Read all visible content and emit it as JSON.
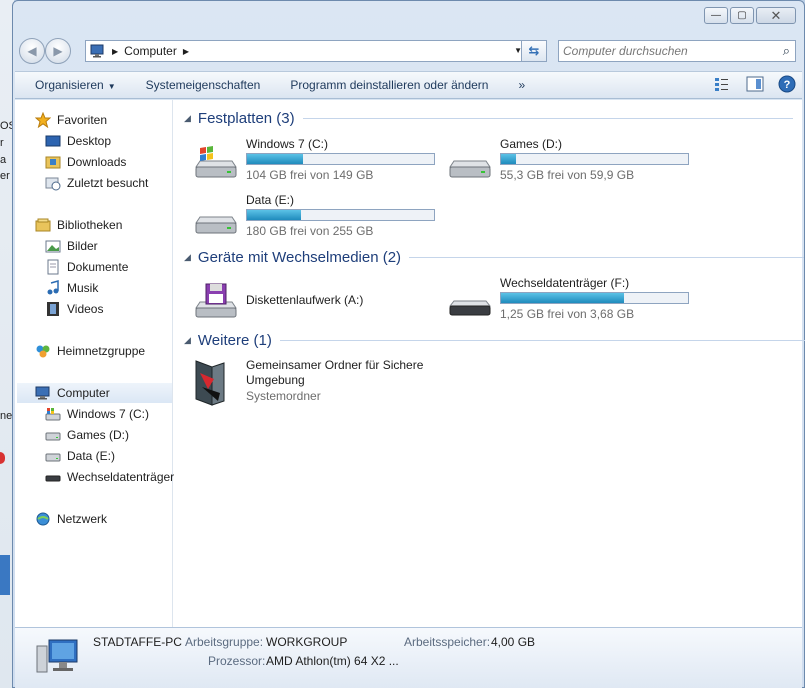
{
  "background_fragments": [
    "OS",
    "r",
    "a",
    "er",
    "ne"
  ],
  "window": {
    "controls": {
      "minimize": "—",
      "maximize": "▢",
      "close": "✕"
    }
  },
  "address": {
    "crumb": "Computer",
    "search_placeholder": "Computer durchsuchen"
  },
  "toolbar": {
    "items": [
      "Organisieren",
      "Systemeigenschaften",
      "Programm deinstallieren oder ändern"
    ],
    "more": "»"
  },
  "sidebar": {
    "favorites": {
      "label": "Favoriten",
      "items": [
        "Desktop",
        "Downloads",
        "Zuletzt besucht"
      ]
    },
    "libraries": {
      "label": "Bibliotheken",
      "items": [
        "Bilder",
        "Dokumente",
        "Musik",
        "Videos"
      ]
    },
    "homegroup": {
      "label": "Heimnetzgruppe"
    },
    "computer": {
      "label": "Computer",
      "items": [
        "Windows 7 (C:)",
        "Games (D:)",
        "Data  (E:)",
        "Wechseldatenträger"
      ]
    },
    "network": {
      "label": "Netzwerk"
    }
  },
  "groups": {
    "hdd": {
      "title": "Festplatten (3)",
      "drives": [
        {
          "name": "Windows 7 (C:)",
          "free": "104 GB frei von 149 GB",
          "used_fraction": 0.3
        },
        {
          "name": "Games (D:)",
          "free": "55,3 GB frei von 59,9 GB",
          "used_fraction": 0.08
        },
        {
          "name": "Data  (E:)",
          "free": "180 GB frei von 255 GB",
          "used_fraction": 0.29
        }
      ]
    },
    "removable": {
      "title": "Geräte mit Wechselmedien (2)",
      "floppy": {
        "name": "Diskettenlaufwerk (A:)"
      },
      "usb": {
        "name": "Wechseldatenträger (F:)",
        "free": "1,25 GB frei von 3,68 GB",
        "used_fraction": 0.66
      }
    },
    "other": {
      "title": "Weitere (1)",
      "item": {
        "name_line1": "Gemeinsamer Ordner für Sichere",
        "name_line2": "Umgebung",
        "type": "Systemordner"
      }
    }
  },
  "details": {
    "pc_name": "STADTAFFE-PC",
    "workgroup_label": "Arbeitsgruppe:",
    "workgroup": "WORKGROUP",
    "memory_label": "Arbeitsspeicher:",
    "memory": "4,00 GB",
    "cpu_label": "Prozessor:",
    "cpu": "AMD Athlon(tm) 64 X2 ..."
  },
  "colors": {
    "bar_fill": "#1f8bbd",
    "group_title": "#1e3e7a",
    "toolbar_text": "#1e395b"
  }
}
